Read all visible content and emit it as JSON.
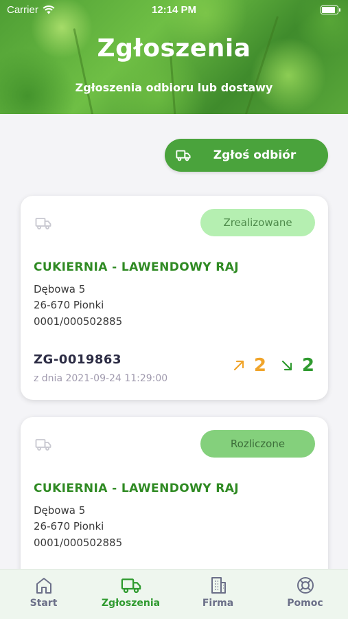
{
  "status_bar": {
    "carrier": "Carrier",
    "time": "12:14 PM"
  },
  "header": {
    "title": "Zgłoszenia",
    "subtitle": "Zgłoszenia odbioru lub dostawy"
  },
  "actions": {
    "report_pickup_label": "Zgłoś odbiór"
  },
  "cards": [
    {
      "status": "Zrealizowane",
      "company": "CUKIERNIA - LAWENDOWY RAJ",
      "street": "Dębowa 5",
      "city": "26-670 Pionki",
      "account": "0001/000502885",
      "number": "ZG-0019863",
      "date": "z dnia 2021-09-24 11:29:00",
      "count_out": "2",
      "count_in": "2"
    },
    {
      "status": "Rozliczone",
      "company": "CUKIERNIA - LAWENDOWY RAJ",
      "street": "Dębowa 5",
      "city": "26-670 Pionki",
      "account": "0001/000502885"
    }
  ],
  "tabbar": {
    "tabs": [
      {
        "label": "Start",
        "icon": "home-icon"
      },
      {
        "label": "Zgłoszenia",
        "icon": "truck-icon"
      },
      {
        "label": "Firma",
        "icon": "building-icon"
      },
      {
        "label": "Pomoc",
        "icon": "lifebuoy-icon"
      }
    ],
    "active": "Zgłoszenia"
  },
  "colors": {
    "accent": "#4aa33c",
    "company_text": "#2f8a23",
    "count_out": "#f0a42a",
    "count_in": "#2f9a2f",
    "badge_done": "#b5efb1",
    "badge_settled": "#84d07c"
  }
}
